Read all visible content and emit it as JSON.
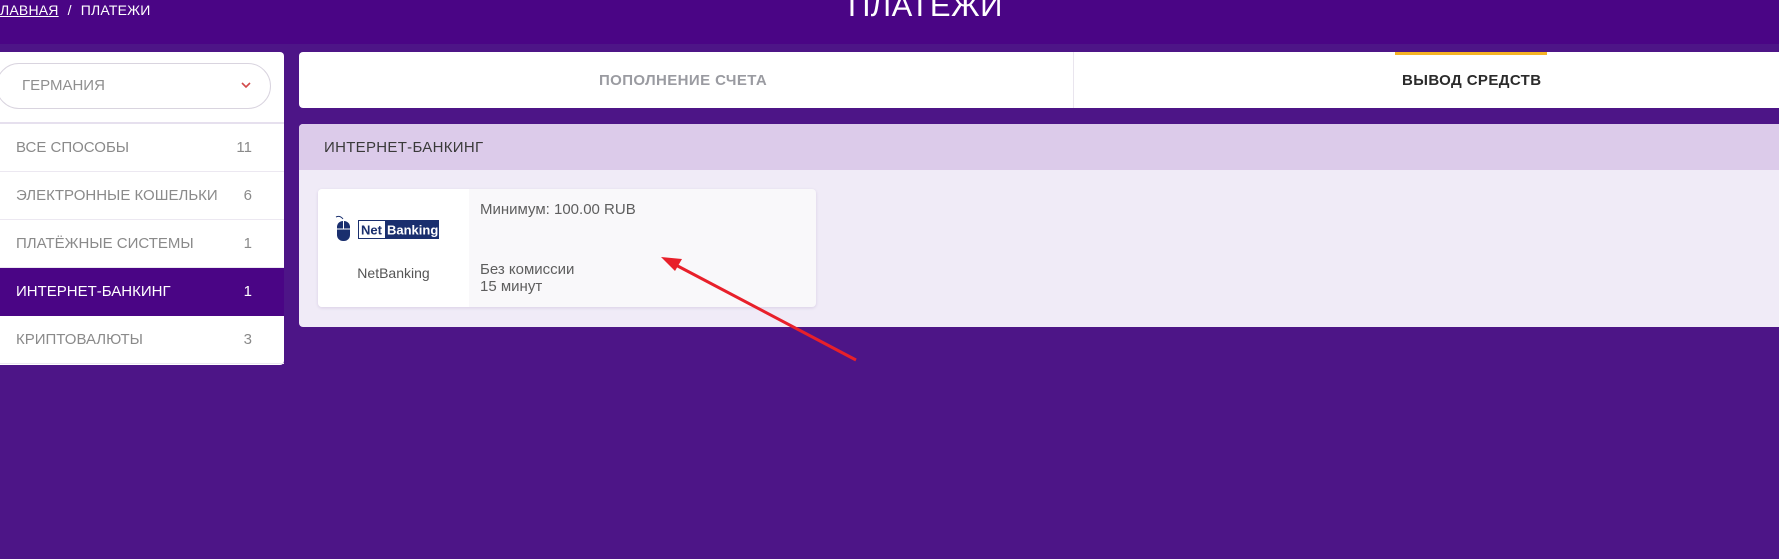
{
  "breadcrumb": {
    "home": "ЛАВНАЯ",
    "separator": "/",
    "current": "ПЛАТЕЖИ"
  },
  "page_title": "ПЛАТЕЖИ",
  "sidebar": {
    "country_select": {
      "value": "ГЕРМАНИЯ",
      "icon": "chevron-down-icon"
    },
    "categories": [
      {
        "label": "ВСЕ СПОСОБЫ",
        "count": "11"
      },
      {
        "label": "ЭЛЕКТРОННЫЕ КОШЕЛЬКИ",
        "count": "6"
      },
      {
        "label": "ПЛАТЁЖНЫЕ СИСТЕМЫ",
        "count": "1"
      },
      {
        "label": "ИНТЕРНЕТ-БАНКИНГ",
        "count": "1",
        "active": true
      },
      {
        "label": "КРИПТОВАЛЮТЫ",
        "count": "3"
      }
    ]
  },
  "tabs": {
    "deposit": "ПОПОЛНЕНИЕ СЧЕТА",
    "withdraw": "ВЫВОД СРЕДСТВ",
    "active": "withdraw"
  },
  "panel": {
    "title": "ИНТЕРНЕТ-БАНКИНГ",
    "methods": [
      {
        "logo_text_1": "Net",
        "logo_text_2": "Banking",
        "name": "NetBanking",
        "minimum": "Минимум: 100.00 RUB",
        "fee": "Без комиссии",
        "time": "15 минут"
      }
    ]
  },
  "colors": {
    "background": "#4d1587",
    "topbar": "#4a0585",
    "active_category": "#4a0585",
    "tab_underline": "#f5b324",
    "panel_header": "#dccbea",
    "panel_body": "#f0ebf7",
    "annotation_arrow": "#e8202a",
    "logo_blue": "#1a2f6e"
  }
}
